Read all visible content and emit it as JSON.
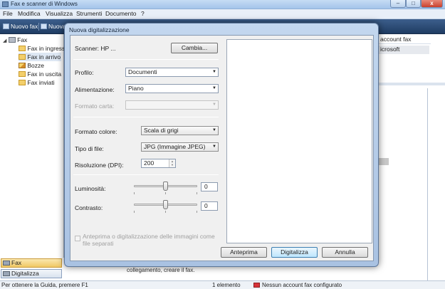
{
  "window": {
    "title": "Fax e scanner di Windows",
    "controls": {
      "minimize": "–",
      "maximize": "□",
      "close": "x"
    }
  },
  "menubar": [
    "File",
    "Modifica",
    "Visualizza",
    "Strumenti",
    "Documento",
    "?"
  ],
  "toolbar": {
    "new_fax": "Nuovo fax",
    "new_scan": "Nuova"
  },
  "nav": {
    "root": {
      "label": "Fax",
      "expander": "◢"
    },
    "folders": [
      "Fax in ingresso",
      "Fax in arrivo",
      "Bozze",
      "Fax in uscita",
      "Fax inviati"
    ],
    "selected": "Fax in arrivo",
    "bottom_buttons": {
      "fax": "Fax",
      "scan": "Digitalizza"
    }
  },
  "background": {
    "column_header": "account fax",
    "row_value": "icrosoft",
    "preview_text": "collegamento, creare il fax."
  },
  "statusbar": {
    "help": "Per ottenere la Guida, premere F1",
    "count": "1 elemento",
    "warning": "Nessun account fax configurato"
  },
  "dialog": {
    "title": "Nuova digitalizzazione",
    "scanner_label": "Scanner: HP ...",
    "change_button": "Cambia...",
    "profile": {
      "label": "Profilo:",
      "value": "Documenti"
    },
    "source": {
      "label": "Alimentazione:",
      "value": "Piano"
    },
    "paper_size": {
      "label": "Formato carta:",
      "value": ""
    },
    "color_format": {
      "label": "Formato colore:",
      "value": "Scala di grigi"
    },
    "file_type": {
      "label": "Tipo di file:",
      "value": "JPG (Immagine JPEG)"
    },
    "resolution": {
      "label": "Risoluzione (DPI):",
      "value": "200"
    },
    "brightness": {
      "label": "Luminosità:",
      "value": "0",
      "min": -100,
      "max": 100
    },
    "contrast": {
      "label": "Contrasto:",
      "value": "0",
      "min": -100,
      "max": 100
    },
    "separate_files_checkbox": "Anteprima o digitalizzazione delle immagini come file separati",
    "buttons": {
      "preview": "Anteprima",
      "scan": "Digitalizza",
      "cancel": "Annulla"
    }
  }
}
